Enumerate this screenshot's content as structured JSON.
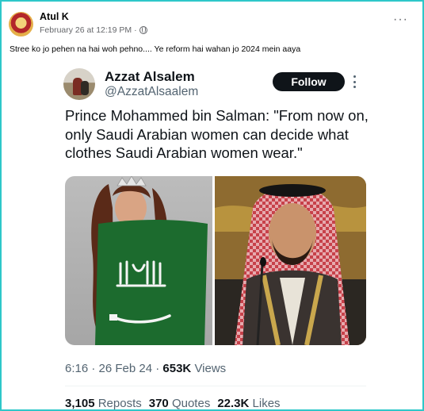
{
  "post": {
    "author": "Atul K",
    "timestamp": "February 26 at 12:19 PM",
    "separator": "·",
    "caption": "Stree ko jo pehen na hai woh pehno.... Ye reform hai wahan jo 2024 mein aaya",
    "more_icon": "ellipsis-icon",
    "privacy_icon": "globe-icon"
  },
  "tweet": {
    "display_name": "Azzat Alsalem",
    "handle": "@AzzatAlsaalem",
    "follow_label": "Follow",
    "text": "Prince Mohammed bin Salman: \"From now on, only Saudi Arabian women can decide what clothes Saudi Arabian women wear.\"",
    "time": "6:16 · 26 Feb 24 · ",
    "views_count": "653K",
    "views_label": "Views",
    "reposts_count": "3,105",
    "reposts_label": "Reposts",
    "quotes_count": "370",
    "quotes_label": "Quotes",
    "likes_count": "22.3K",
    "likes_label": "Likes"
  },
  "colors": {
    "frame_border": "#2ec7c9",
    "follow_button": "#0f1419",
    "secondary_text": "#536471",
    "flag_green": "#1c6b2e"
  }
}
